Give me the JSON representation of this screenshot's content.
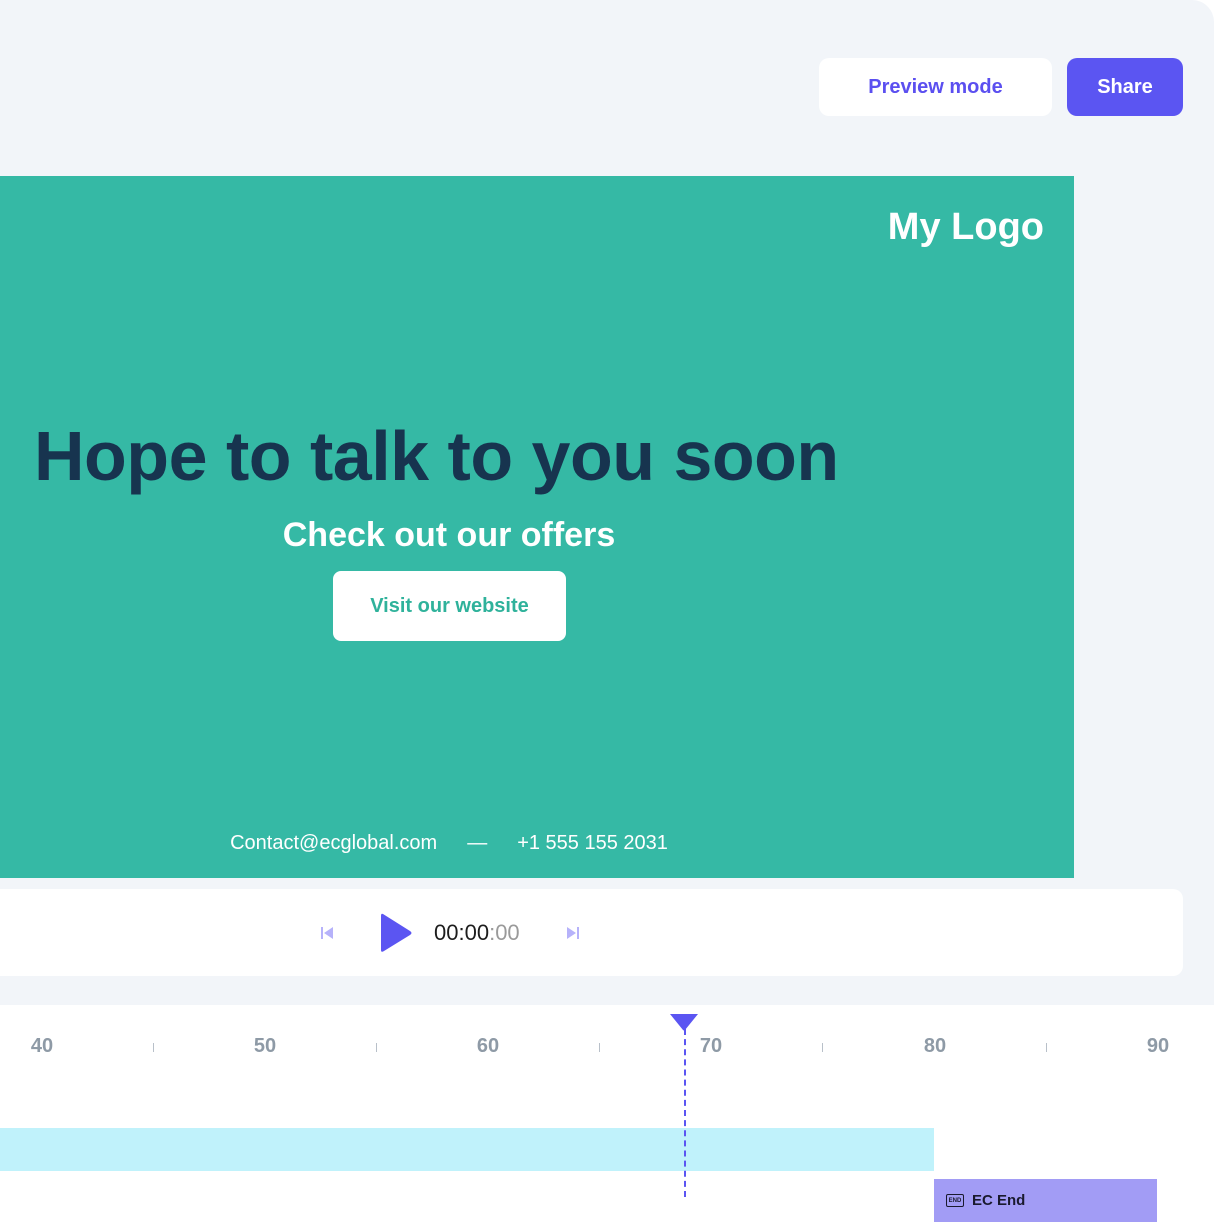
{
  "toolbar": {
    "preview_label": "Preview mode",
    "share_label": "Share"
  },
  "canvas": {
    "logo": "My Logo",
    "headline": "Hope to talk to you soon",
    "subline": "Check out our offers",
    "cta_label": "Visit our website",
    "email": "Contact@ecglobal.com",
    "separator": "—",
    "phone": "+1 555 155 2031",
    "background_color": "#35b9a5"
  },
  "player": {
    "time_main": "00:00",
    "time_sep": ":",
    "time_frac": "00"
  },
  "timeline": {
    "ticks": [
      "40",
      "50",
      "60",
      "70",
      "80",
      "90"
    ],
    "end_block_label": "EC End",
    "end_icon_text": "END"
  },
  "colors": {
    "accent": "#5b55f2",
    "headline": "#17344f",
    "track": "#c0f2fb",
    "end_block": "#a29cf5"
  }
}
